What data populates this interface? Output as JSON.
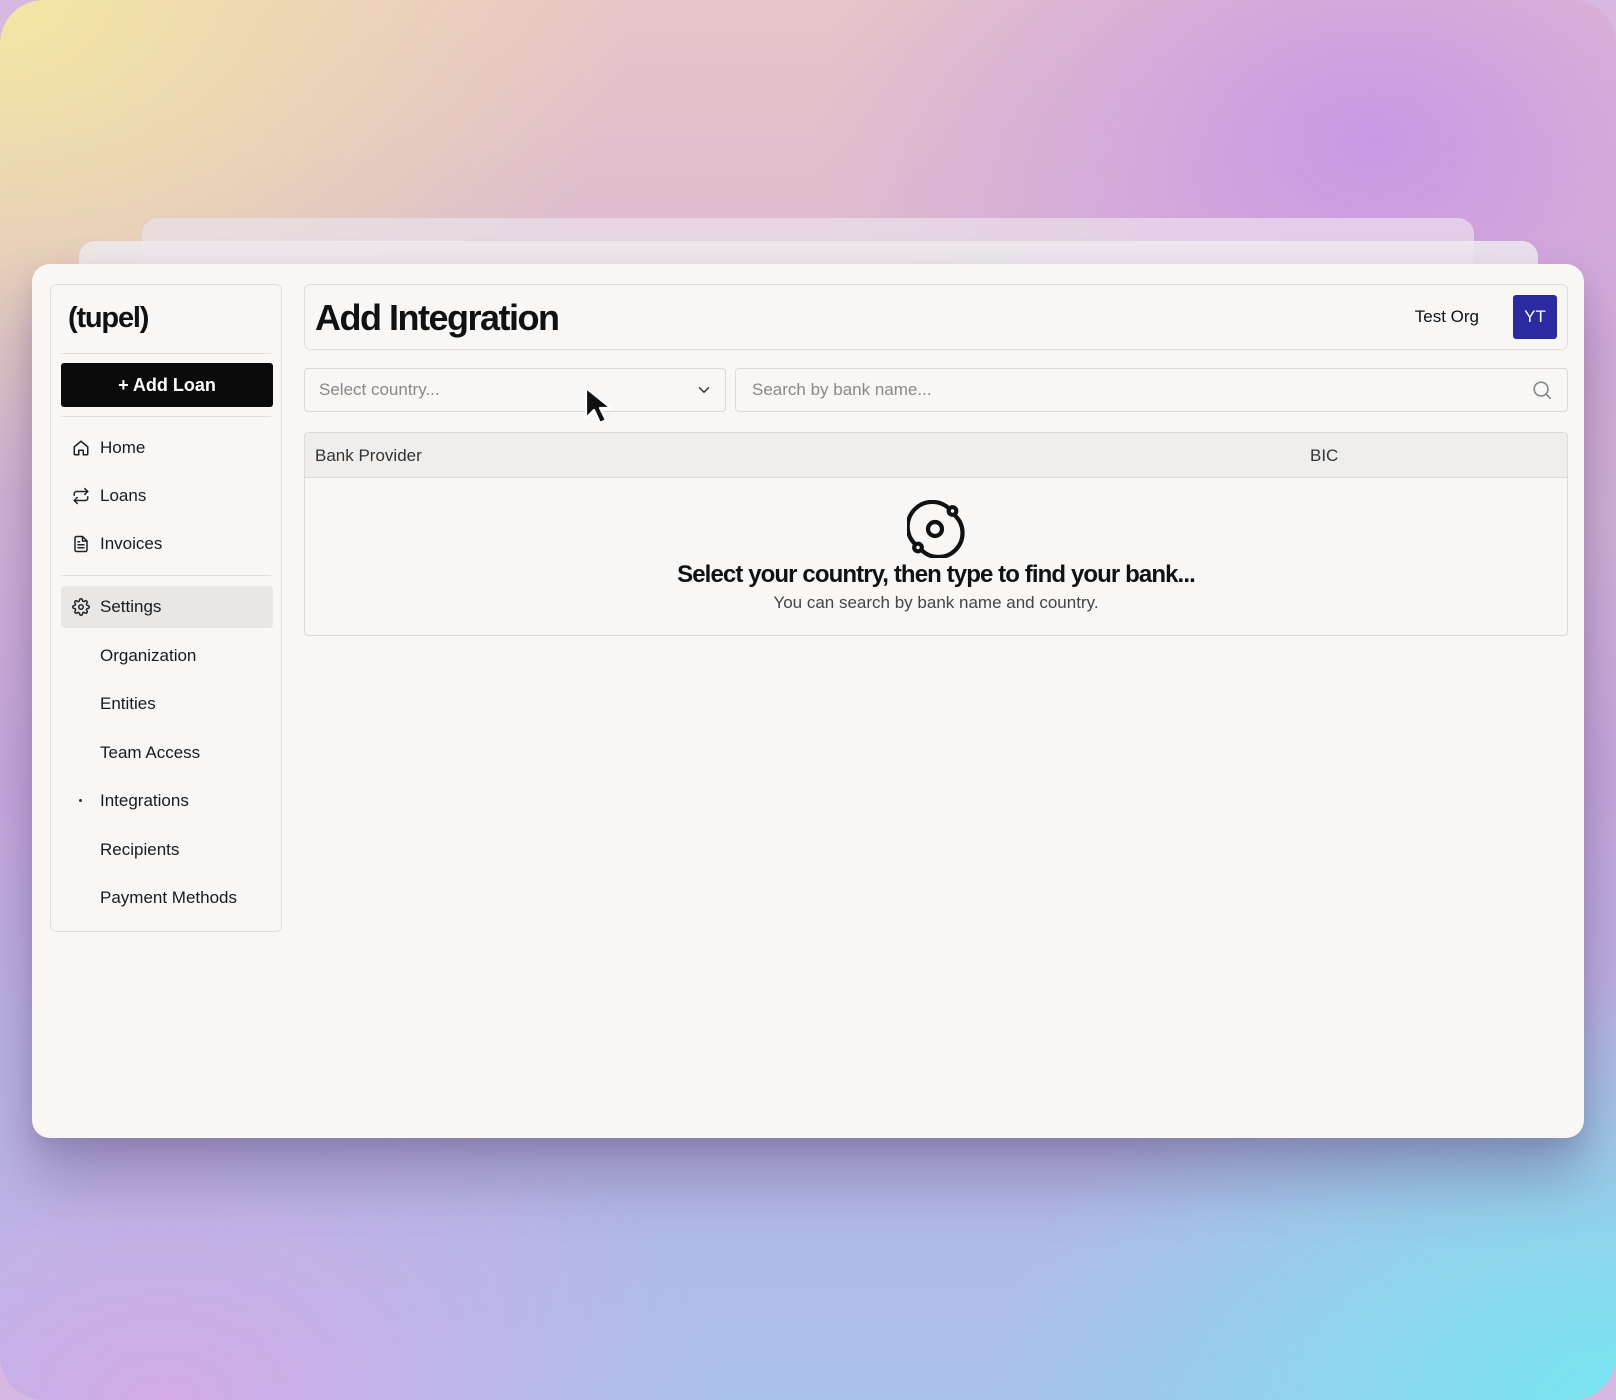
{
  "app": {
    "logo": "(tupel)"
  },
  "sidebar": {
    "add_button": "+ Add Loan",
    "nav": [
      {
        "label": "Home",
        "icon": "home-icon"
      },
      {
        "label": "Loans",
        "icon": "arrows-icon"
      },
      {
        "label": "Invoices",
        "icon": "document-icon"
      }
    ],
    "settings": {
      "label": "Settings",
      "icon": "gear-icon"
    },
    "sub": [
      {
        "label": "Organization"
      },
      {
        "label": "Entities"
      },
      {
        "label": "Team Access"
      },
      {
        "label": "Integrations",
        "current": true
      },
      {
        "label": "Recipients"
      },
      {
        "label": "Payment Methods"
      }
    ]
  },
  "header": {
    "title": "Add Integration",
    "org": "Test Org",
    "avatar_initials": "YT",
    "avatar_color": "#2c2aa0"
  },
  "filters": {
    "country_placeholder": "Select country...",
    "search_placeholder": "Search by bank name..."
  },
  "table": {
    "columns": [
      "Bank Provider",
      "BIC"
    ],
    "empty_icon": "orbit-icon",
    "empty_title": "Select your country, then type to find your bank...",
    "empty_subtitle": "You can search by bank name and country."
  }
}
